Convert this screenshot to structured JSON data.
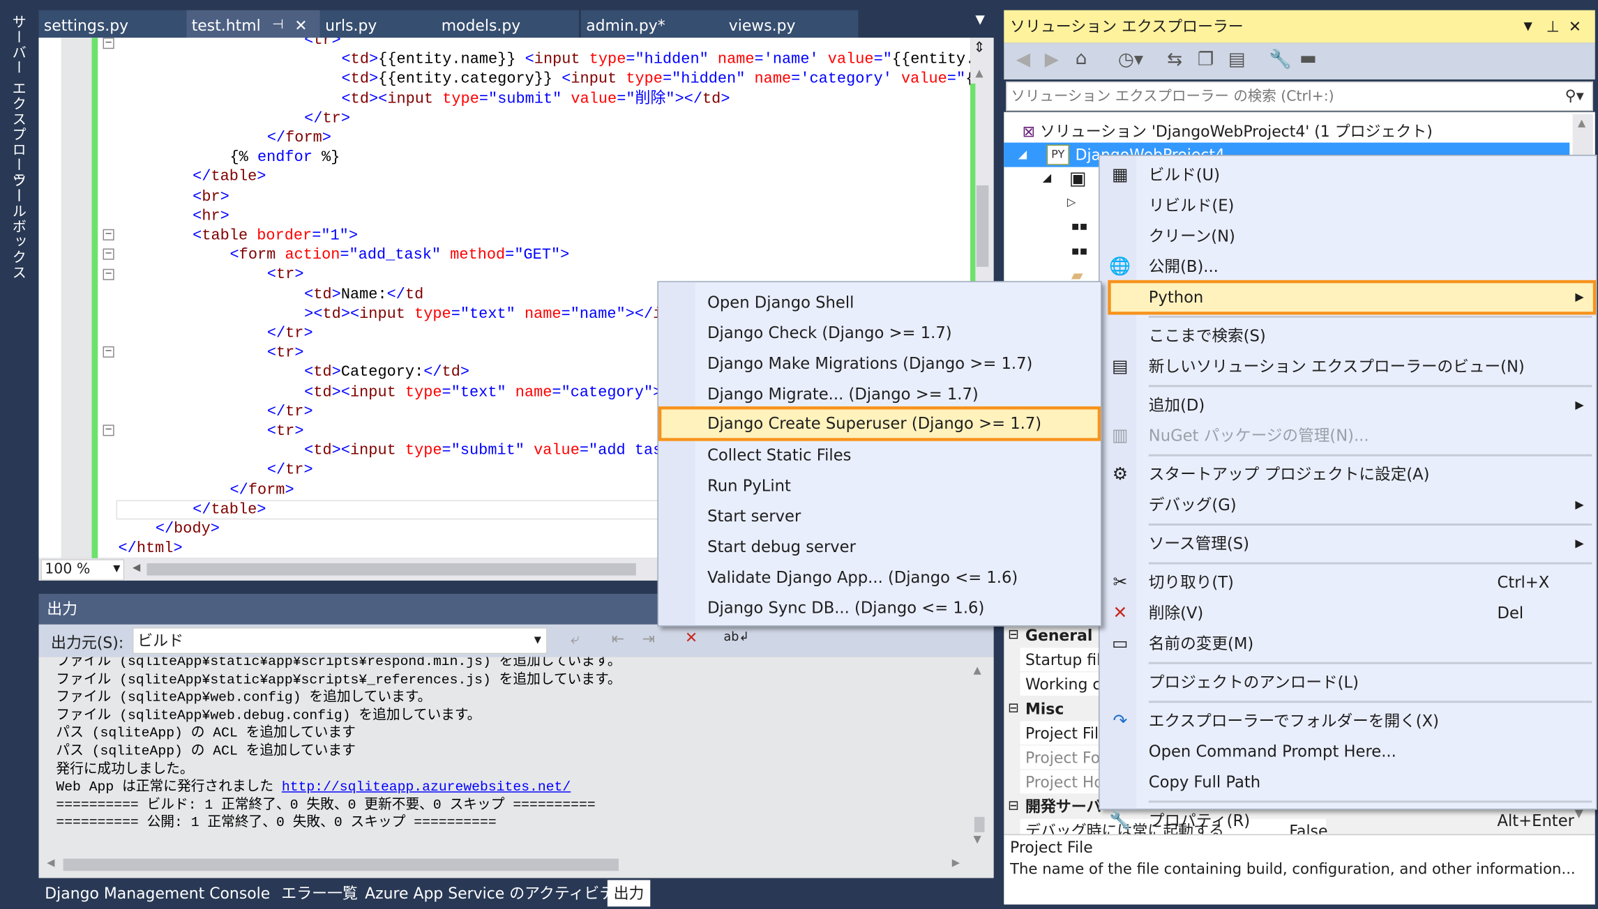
{
  "side_tabs": [
    "サーバー エクスプローラー",
    "ツールボックス"
  ],
  "editor": {
    "tabs": [
      {
        "label": "settings.py",
        "active": false
      },
      {
        "label": "test.html",
        "active": true
      },
      {
        "label": "urls.py",
        "active": false
      },
      {
        "label": "models.py",
        "active": false
      },
      {
        "label": "admin.py*",
        "active": false
      },
      {
        "label": "views.py",
        "active": false
      }
    ],
    "pin_icon": "pin-icon",
    "close_icon": "close-icon",
    "zoom": "100 %",
    "lines": [
      {
        "indent": 5,
        "tokens": [
          [
            "b",
            "<"
          ],
          [
            "t",
            "tr"
          ],
          [
            "b",
            ">"
          ]
        ]
      },
      {
        "indent": 6,
        "tokens": [
          [
            "b",
            "<"
          ],
          [
            "t",
            "td"
          ],
          [
            "b",
            ">"
          ],
          [
            "x",
            "{{entity.name}} "
          ],
          [
            "b",
            "<"
          ],
          [
            "t",
            "input "
          ],
          [
            "a",
            "type"
          ],
          [
            "b",
            "="
          ],
          [
            "v",
            "\"hidden\" "
          ],
          [
            "a",
            "name"
          ],
          [
            "b",
            "="
          ],
          [
            "v",
            "'name' "
          ],
          [
            "a",
            "value"
          ],
          [
            "b",
            "="
          ],
          [
            "v",
            "\""
          ],
          [
            "x",
            "{{entity.n"
          ]
        ]
      },
      {
        "indent": 6,
        "tokens": [
          [
            "b",
            "<"
          ],
          [
            "t",
            "td"
          ],
          [
            "b",
            ">"
          ],
          [
            "x",
            "{{entity.category}} "
          ],
          [
            "b",
            "<"
          ],
          [
            "t",
            "input "
          ],
          [
            "a",
            "type"
          ],
          [
            "b",
            "="
          ],
          [
            "v",
            "\"hidden\" "
          ],
          [
            "a",
            "name"
          ],
          [
            "b",
            "="
          ],
          [
            "v",
            "'category' "
          ],
          [
            "a",
            "value"
          ],
          [
            "b",
            "="
          ],
          [
            "v",
            "\""
          ],
          [
            "x",
            "{{"
          ]
        ]
      },
      {
        "indent": 6,
        "tokens": [
          [
            "b",
            "<"
          ],
          [
            "t",
            "td"
          ],
          [
            "b",
            "><"
          ],
          [
            "t",
            "input "
          ],
          [
            "a",
            "type"
          ],
          [
            "b",
            "="
          ],
          [
            "v",
            "\"submit\" "
          ],
          [
            "a",
            "value"
          ],
          [
            "b",
            "="
          ],
          [
            "v",
            "\"削除\""
          ],
          [
            "b",
            "></"
          ],
          [
            "t",
            "td"
          ],
          [
            "b",
            ">"
          ]
        ]
      },
      {
        "indent": 5,
        "tokens": [
          [
            "b",
            "</"
          ],
          [
            "t",
            "tr"
          ],
          [
            "b",
            ">"
          ]
        ]
      },
      {
        "indent": 4,
        "tokens": [
          [
            "b",
            "</"
          ],
          [
            "t",
            "form"
          ],
          [
            "b",
            ">"
          ]
        ]
      },
      {
        "indent": 3,
        "tokens": [
          [
            "x",
            "{% "
          ],
          [
            "k",
            "endfor"
          ],
          [
            "x",
            " %}"
          ]
        ]
      },
      {
        "indent": 2,
        "tokens": [
          [
            "b",
            "</"
          ],
          [
            "t",
            "table"
          ],
          [
            "b",
            ">"
          ]
        ]
      },
      {
        "indent": 2,
        "tokens": [
          [
            "b",
            "<"
          ],
          [
            "t",
            "br"
          ],
          [
            "b",
            ">"
          ]
        ]
      },
      {
        "indent": 2,
        "tokens": [
          [
            "b",
            "<"
          ],
          [
            "t",
            "hr"
          ],
          [
            "b",
            ">"
          ]
        ]
      },
      {
        "indent": 2,
        "tokens": [
          [
            "b",
            "<"
          ],
          [
            "t",
            "table "
          ],
          [
            "a",
            "border"
          ],
          [
            "b",
            "="
          ],
          [
            "v",
            "\"1\""
          ],
          [
            "b",
            ">"
          ]
        ]
      },
      {
        "indent": 3,
        "tokens": [
          [
            "b",
            "<"
          ],
          [
            "t",
            "form "
          ],
          [
            "a",
            "action"
          ],
          [
            "b",
            "="
          ],
          [
            "v",
            "\"add_task\" "
          ],
          [
            "a",
            "method"
          ],
          [
            "b",
            "="
          ],
          [
            "v",
            "\"GET\""
          ],
          [
            "b",
            ">"
          ]
        ]
      },
      {
        "indent": 4,
        "tokens": [
          [
            "b",
            "<"
          ],
          [
            "t",
            "tr"
          ],
          [
            "b",
            ">"
          ]
        ]
      },
      {
        "indent": 5,
        "tokens": [
          [
            "b",
            "<"
          ],
          [
            "t",
            "td"
          ],
          [
            "b",
            ">"
          ],
          [
            "x",
            "Name:"
          ],
          [
            "b",
            "</"
          ],
          [
            "t",
            "td"
          ]
        ]
      },
      {
        "indent": 5,
        "tokens": [
          [
            "b",
            "><"
          ],
          [
            "t",
            "td"
          ],
          [
            "b",
            "><"
          ],
          [
            "t",
            "input "
          ],
          [
            "a",
            "type"
          ],
          [
            "b",
            "="
          ],
          [
            "v",
            "\"text\" "
          ],
          [
            "a",
            "name"
          ],
          [
            "b",
            "="
          ],
          [
            "v",
            "\"name\""
          ],
          [
            "b",
            "></"
          ],
          [
            "t",
            "in"
          ]
        ]
      },
      {
        "indent": 4,
        "tokens": [
          [
            "b",
            "</"
          ],
          [
            "t",
            "tr"
          ],
          [
            "b",
            ">"
          ]
        ]
      },
      {
        "indent": 4,
        "tokens": [
          [
            "b",
            "<"
          ],
          [
            "t",
            "tr"
          ],
          [
            "b",
            ">"
          ]
        ]
      },
      {
        "indent": 5,
        "tokens": [
          [
            "b",
            "<"
          ],
          [
            "t",
            "td"
          ],
          [
            "b",
            ">"
          ],
          [
            "x",
            "Category:"
          ],
          [
            "b",
            "</"
          ],
          [
            "t",
            "td"
          ],
          [
            "b",
            ">"
          ]
        ]
      },
      {
        "indent": 5,
        "tokens": [
          [
            "b",
            "<"
          ],
          [
            "t",
            "td"
          ],
          [
            "b",
            "><"
          ],
          [
            "t",
            "input "
          ],
          [
            "a",
            "type"
          ],
          [
            "b",
            "="
          ],
          [
            "v",
            "\"text\" "
          ],
          [
            "a",
            "name"
          ],
          [
            "b",
            "="
          ],
          [
            "v",
            "\"category\""
          ],
          [
            "b",
            "><"
          ]
        ]
      },
      {
        "indent": 4,
        "tokens": [
          [
            "b",
            "</"
          ],
          [
            "t",
            "tr"
          ],
          [
            "b",
            ">"
          ]
        ]
      },
      {
        "indent": 4,
        "tokens": [
          [
            "b",
            "<"
          ],
          [
            "t",
            "tr"
          ],
          [
            "b",
            ">"
          ]
        ]
      },
      {
        "indent": 5,
        "tokens": [
          [
            "b",
            "<"
          ],
          [
            "t",
            "td"
          ],
          [
            "b",
            "><"
          ],
          [
            "t",
            "input "
          ],
          [
            "a",
            "type"
          ],
          [
            "b",
            "="
          ],
          [
            "v",
            "\"submit\" "
          ],
          [
            "a",
            "value"
          ],
          [
            "b",
            "="
          ],
          [
            "v",
            "\"add task"
          ]
        ]
      },
      {
        "indent": 4,
        "tokens": [
          [
            "b",
            "</"
          ],
          [
            "t",
            "tr"
          ],
          [
            "b",
            ">"
          ]
        ]
      },
      {
        "indent": 3,
        "tokens": [
          [
            "b",
            "</"
          ],
          [
            "t",
            "form"
          ],
          [
            "b",
            ">"
          ]
        ]
      },
      {
        "indent": 2,
        "tokens": [
          [
            "b",
            "</"
          ],
          [
            "t",
            "table"
          ],
          [
            "b",
            ">"
          ]
        ]
      },
      {
        "indent": 1,
        "tokens": [
          [
            "b",
            "</"
          ],
          [
            "t",
            "body"
          ],
          [
            "b",
            ">"
          ]
        ]
      },
      {
        "indent": 0,
        "tokens": [
          [
            "b",
            "</"
          ],
          [
            "t",
            "html"
          ],
          [
            "b",
            ">"
          ]
        ]
      }
    ]
  },
  "output": {
    "title": "出力",
    "source_label": "出力元(S):",
    "source_value": "ビルド",
    "lines": [
      "ファイル (sqliteApp¥static¥app¥scripts¥respond.min.js) を追加しています。",
      "ファイル (sqliteApp¥static¥app¥scripts¥_references.js) を追加しています。",
      "ファイル (sqliteApp¥web.config) を追加しています。",
      "ファイル (sqliteApp¥web.debug.config) を追加しています。",
      "パス (sqliteApp) の ACL を追加しています",
      "パス (sqliteApp) の ACL を追加しています",
      "発行に成功しました。",
      "Web App は正常に発行されました ",
      "========== ビルド: 1 正常終了、0 失敗、0 更新不要、0 スキップ ==========",
      "========== 公開: 1 正常終了、0 失敗、0 スキップ =========="
    ],
    "link": "http://sqliteapp.azurewebsites.net/"
  },
  "bottom_tabs": [
    {
      "label": "Django Management Console",
      "active": false
    },
    {
      "label": "エラー一覧",
      "active": false
    },
    {
      "label": "Azure App Service のアクティビティ",
      "active": false
    },
    {
      "label": "出力",
      "active": true
    }
  ],
  "solution_explorer": {
    "title": "ソリューション エクスプローラー",
    "search_placeholder": "ソリューション エクスプローラー の検索 (Ctrl+:)",
    "solution_label": "ソリューション 'DjangoWebProject4' (1 プロジェクト)",
    "project_label": "DjangoWebProject4",
    "properties": [
      {
        "kind": "cat",
        "label": "General"
      },
      {
        "kind": "row",
        "label": "Startup fil"
      },
      {
        "kind": "row",
        "label": "Working c"
      },
      {
        "kind": "cat",
        "label": "Misc"
      },
      {
        "kind": "row",
        "label": "Project Fil"
      },
      {
        "kind": "row",
        "label": "Project Fo",
        "dim": true
      },
      {
        "kind": "row",
        "label": "Project Ho",
        "dim": true
      },
      {
        "kind": "cat",
        "label": "開発サーバ"
      },
      {
        "kind": "row",
        "label": "デバッグ時には常に起動する",
        "value": "False"
      }
    ],
    "desc_title": "Project File",
    "desc_text": "The name of the file containing build, configuration, and other information..."
  },
  "context_menu": {
    "items": [
      {
        "label": "ビルド(U)",
        "icon": "build-icon",
        "glyph": "▦"
      },
      {
        "label": "リビルド(E)"
      },
      {
        "label": "クリーン(N)"
      },
      {
        "label": "公開(B)...",
        "icon": "globe-icon",
        "glyph": "🌐"
      },
      {
        "label": "Python",
        "submenu": true,
        "highlighted": true
      },
      {
        "sep": true
      },
      {
        "label": "ここまで検索(S)"
      },
      {
        "label": "新しいソリューション エクスプローラーのビュー(N)",
        "icon": "new-view-icon",
        "glyph": "▤"
      },
      {
        "sep": true
      },
      {
        "label": "追加(D)",
        "submenu": true
      },
      {
        "label": "NuGet パッケージの管理(N)...",
        "icon": "nuget-icon",
        "glyph": "▥",
        "disabled": true
      },
      {
        "sep": true
      },
      {
        "label": "スタートアップ プロジェクトに設定(A)",
        "icon": "gear-icon",
        "glyph": "⚙"
      },
      {
        "label": "デバッグ(G)",
        "submenu": true
      },
      {
        "sep": true
      },
      {
        "label": "ソース管理(S)",
        "submenu": true
      },
      {
        "sep": true
      },
      {
        "label": "切り取り(T)",
        "shortcut": "Ctrl+X",
        "icon": "scissors-icon",
        "glyph": "✂"
      },
      {
        "label": "削除(V)",
        "shortcut": "Del",
        "icon": "delete-icon",
        "glyph": "✕",
        "color": "#c8281e"
      },
      {
        "label": "名前の変更(M)",
        "icon": "rename-icon",
        "glyph": "▭"
      },
      {
        "sep": true
      },
      {
        "label": "プロジェクトのアンロード(L)"
      },
      {
        "sep": true
      },
      {
        "label": "エクスプローラーでフォルダーを開く(X)",
        "icon": "open-folder-arrow-icon",
        "glyph": "↷",
        "color": "#1e6fc8"
      },
      {
        "label": "Open Command Prompt Here..."
      },
      {
        "label": "Copy Full Path"
      },
      {
        "sep": true
      },
      {
        "label": "プロパティ(R)",
        "shortcut": "Alt+Enter",
        "icon": "wrench-icon",
        "glyph": "🔧"
      }
    ]
  },
  "python_menu": {
    "items": [
      {
        "label": "Open Django Shell"
      },
      {
        "label": "Django Check (Django >= 1.7)"
      },
      {
        "label": "Django Make Migrations (Django >= 1.7)"
      },
      {
        "label": "Django Migrate... (Django >= 1.7)"
      },
      {
        "label": "Django Create Superuser (Django >= 1.7)",
        "highlighted": true
      },
      {
        "label": "Collect Static Files"
      },
      {
        "label": "Run PyLint"
      },
      {
        "label": "Start server"
      },
      {
        "label": "Start debug server"
      },
      {
        "label": "Validate Django App... (Django <= 1.6)"
      },
      {
        "label": "Django Sync DB... (Django <= 1.6)"
      }
    ]
  },
  "colors": {
    "highlight_border": "#f7931e",
    "highlight_bg": "#fff2bd",
    "selection": "#3399ff",
    "title_yellow": "#fff29d",
    "ide_bg": "#293955"
  }
}
